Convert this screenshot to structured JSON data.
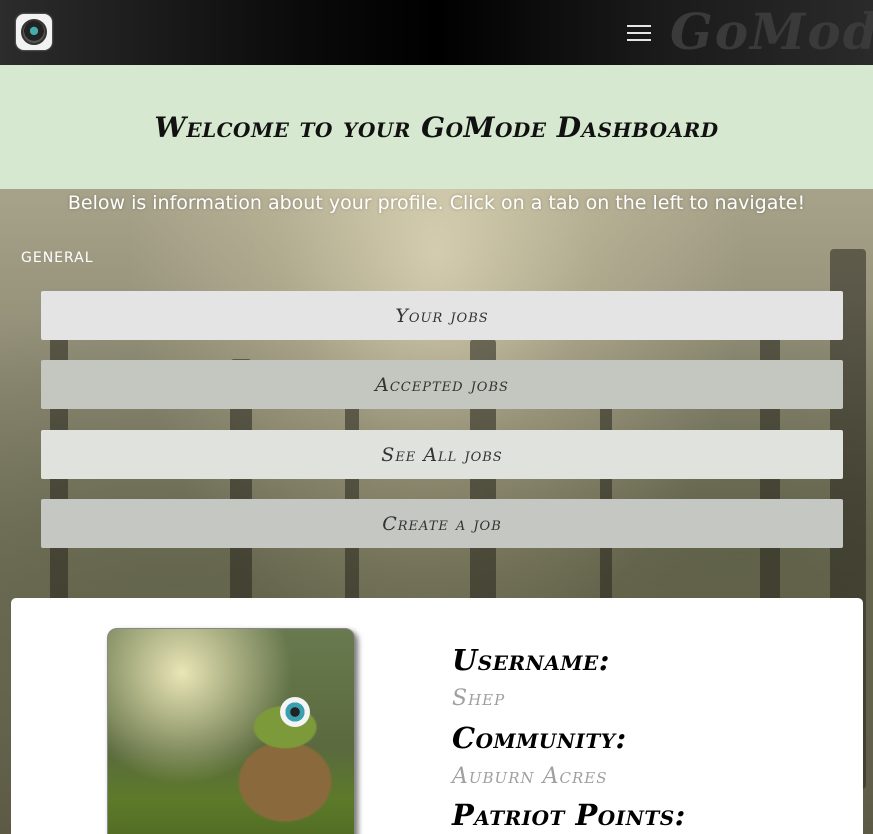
{
  "header": {
    "menu_icon": "hamburger-menu-icon",
    "brand_watermark": "GoMode"
  },
  "welcome": {
    "title": "Welcome to your GoMode Dashboard"
  },
  "intro": {
    "subtitle": "Below is information about your profile. Click on a tab on the left to navigate!"
  },
  "general": {
    "section_label": "GENERAL",
    "tabs": [
      {
        "label": "Your jobs"
      },
      {
        "label": "Accepted jobs"
      },
      {
        "label": "See All jobs"
      },
      {
        "label": "Create a job"
      }
    ]
  },
  "profile": {
    "username_label": "Username:",
    "username_value": "Shep",
    "community_label": "Community:",
    "community_value": "Auburn Acres",
    "points_label": "Patriot Points:"
  },
  "colors": {
    "welcome_bg": "#d6e8d0",
    "navbar": "#000000"
  }
}
